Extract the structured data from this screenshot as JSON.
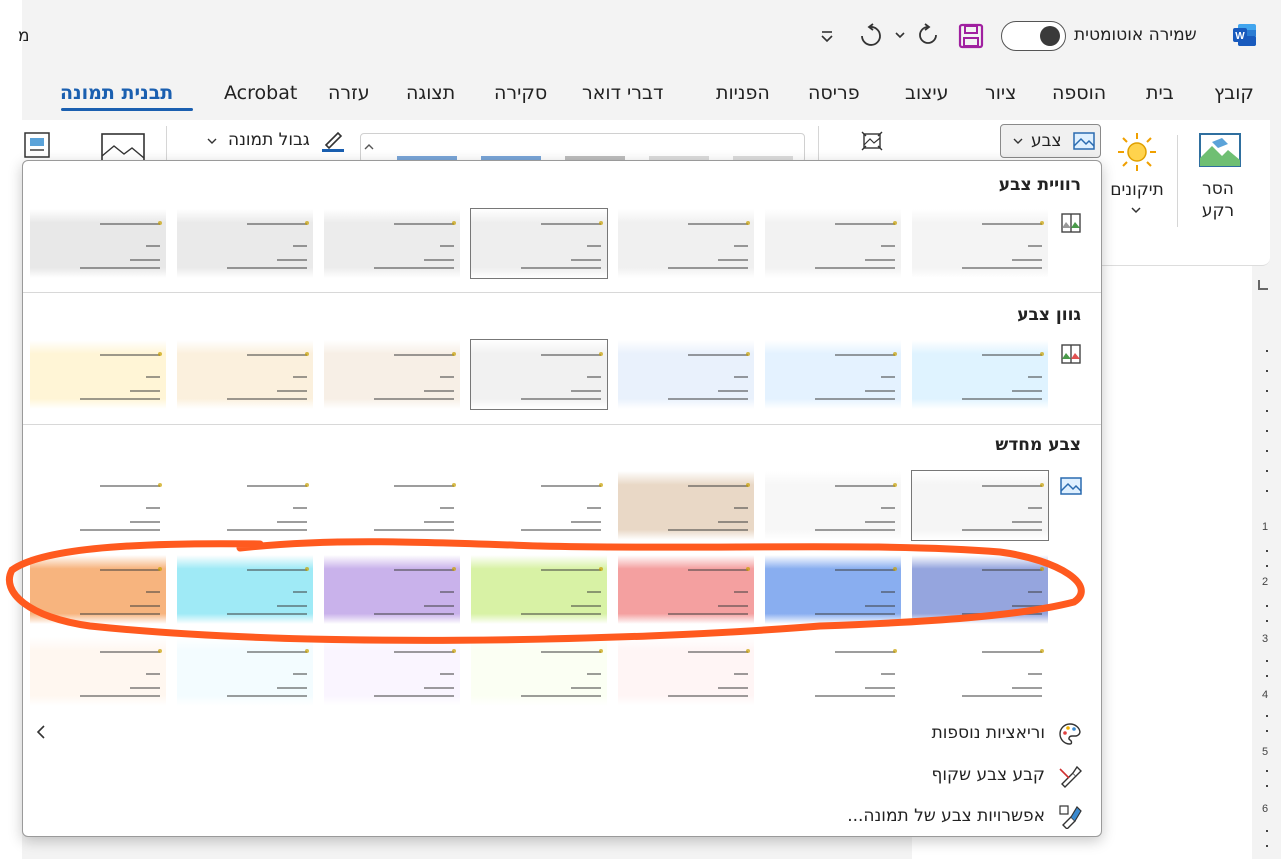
{
  "titlebar": {
    "autosave_label": "שמירה אוטומטית",
    "left_cut_text": "מ"
  },
  "tabs": [
    {
      "label": "קובץ",
      "active": false
    },
    {
      "label": "בית",
      "active": false
    },
    {
      "label": "הוספה",
      "active": false
    },
    {
      "label": "ציור",
      "active": false
    },
    {
      "label": "עיצוב",
      "active": false
    },
    {
      "label": "פריסה",
      "active": false
    },
    {
      "label": "הפניות",
      "active": false
    },
    {
      "label": "דברי דואר",
      "active": false
    },
    {
      "label": "סקירה",
      "active": false
    },
    {
      "label": "תצוגה",
      "active": false
    },
    {
      "label": "עזרה",
      "active": false
    },
    {
      "label": "Acrobat",
      "active": false
    },
    {
      "label": "תבנית תמונה",
      "active": true
    }
  ],
  "ribbon": {
    "remove_bg_line1": "הסר",
    "remove_bg_line2": "רקע",
    "corrections_label": "תיקונים",
    "color_label": "צבע",
    "picture_border_label": "גבול תמונה"
  },
  "panel": {
    "saturation_header": "רוויית צבע",
    "tone_header": "גוון צבע",
    "recolor_header": "צבע מחדש",
    "more_variations": "וריאציות נוספות",
    "set_transparent": "קבע צבע שקוף",
    "color_options": "אפשרויות צבע של תמונה..."
  },
  "colors": {
    "accent": "#1a5fb0",
    "annotation": "#ff5a1f",
    "word_blue": "#185abd",
    "save_purple": "#a020a0"
  },
  "swatch_rows": {
    "saturation": [
      "#f4f4f4",
      "#f2f2f2",
      "#f0f0f0",
      "#eeeeee",
      "#ececec",
      "#eaeaea",
      "#e8e8e8"
    ],
    "tone": [
      "#dff3ff",
      "#e4f2ff",
      "#e9f1fc",
      "#f1f1f1",
      "#f7efe6",
      "#fbf0dd",
      "#fff5d6"
    ],
    "recolor_1": [
      "#f5f5f5",
      "#f7f7f7",
      "#e9d8c6",
      "#ffffff",
      "#ffffff",
      "#ffffff",
      "#ffffff"
    ],
    "recolor_2": [
      "#95a5de",
      "#89aef0",
      "#f4a0a0",
      "#d8f2a5",
      "#c9b2eb",
      "#9feaf6",
      "#f7b47e"
    ],
    "recolor_3": [
      "#ffffff",
      "#ffffff",
      "#fff5f5",
      "#fbfff3",
      "#faf5ff",
      "#f3fcff",
      "#fff7f0"
    ]
  }
}
